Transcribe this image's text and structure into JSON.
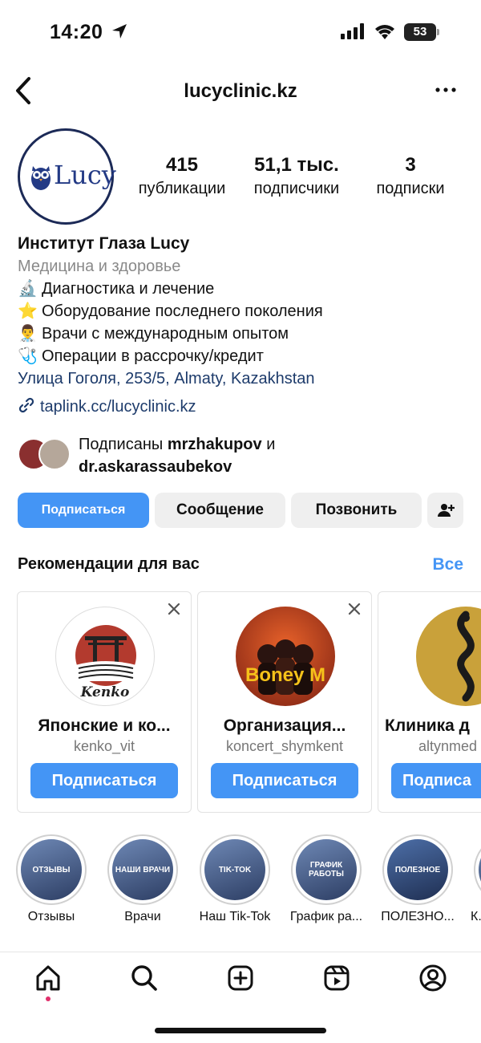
{
  "status_bar": {
    "time": "14:20",
    "battery": "53"
  },
  "header": {
    "title": "lucyclinic.kz"
  },
  "profile": {
    "avatar_text": "Lucy",
    "stats": [
      {
        "value": "415",
        "label": "публикации"
      },
      {
        "value": "51,1 тыс.",
        "label": "подписчики"
      },
      {
        "value": "3",
        "label": "подписки"
      }
    ],
    "name": "Институт Глаза Lucy",
    "category": "Медицина и здоровье",
    "bio_lines": [
      {
        "emoji": "🔬",
        "text": "Диагностика и лечение"
      },
      {
        "emoji": "⭐",
        "text": "Оборудование последнего поколения"
      },
      {
        "emoji": "👨‍⚕️",
        "text": "Врачи с международным опытом"
      },
      {
        "emoji": "🩺",
        "text": "Операции в рассрочку/кредит"
      }
    ],
    "address": "Улица Гоголя, 253/5, Almaty, Kazakhstan",
    "link": "taplink.cc/lucyclinic.kz",
    "followed_by": {
      "prefix": "Подписаны",
      "user1": "mrzhakupov",
      "conj": "и",
      "user2": "dr.askarassaubekov"
    }
  },
  "actions": {
    "follow": "Подписаться",
    "message": "Сообщение",
    "call": "Позвонить"
  },
  "recommendations": {
    "title": "Рекомендации для вас",
    "see_all": "Все",
    "cards": [
      {
        "name": "Японские и ко...",
        "handle": "kenko_vit",
        "button": "Подписаться",
        "pic_text": "Kenko"
      },
      {
        "name": "Организация...",
        "handle": "koncert_shymkent",
        "button": "Подписаться",
        "pic_text": "Boney M"
      },
      {
        "name": "Клиника д",
        "handle": "altynmed",
        "button": "Подписа"
      }
    ]
  },
  "highlights": [
    {
      "cover": "ОТЗЫВЫ",
      "label": "Отзывы"
    },
    {
      "cover": "НАШИ ВРАЧИ",
      "label": "Врачи"
    },
    {
      "cover": "TIK-TOK",
      "label": "Наш Tik-Tok"
    },
    {
      "cover": "ГРАФИК РАБОТЫ",
      "label": "График ра..."
    },
    {
      "cover": "ПОЛЕЗНОЕ",
      "label": "ПОЛЕЗНО..."
    },
    {
      "cover": "",
      "label": "К..."
    }
  ],
  "tabbar": [
    "home-icon",
    "search-icon",
    "create-icon",
    "reels-icon",
    "profile-icon"
  ],
  "colors": {
    "accent": "#4495f5",
    "link": "#1d3b6b",
    "brand": "#233a85",
    "notification": "#e1306c"
  }
}
